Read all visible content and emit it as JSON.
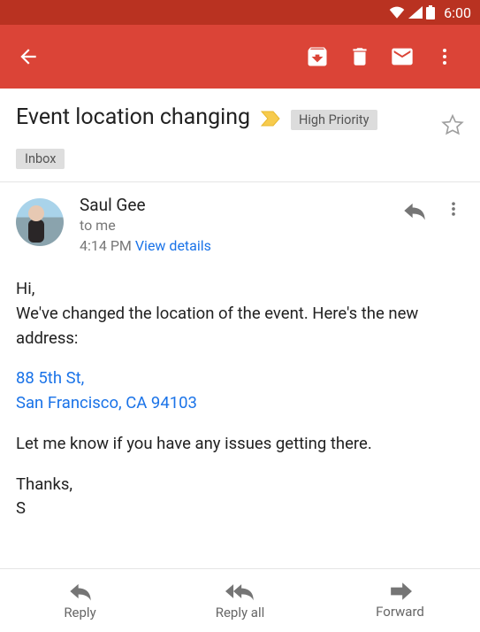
{
  "status": {
    "time": "6:00"
  },
  "email": {
    "subject": "Event location changing",
    "priority_label": "High Priority",
    "folder": "Inbox",
    "sender": "Saul Gee",
    "recipient": "to me",
    "sent_time": "4:14 PM",
    "view_details": "View details",
    "body_greeting": "Hi,",
    "body_line1": "We've changed the location of the event. Here's the new address:",
    "address_line1": "88 5th St,",
    "address_line2": "San Francisco, CA 94103",
    "body_line2": "Let me know if you have any issues getting there.",
    "closing1": "Thanks,",
    "closing2": "S"
  },
  "actions": {
    "reply": "Reply",
    "reply_all": "Reply all",
    "forward": "Forward"
  }
}
